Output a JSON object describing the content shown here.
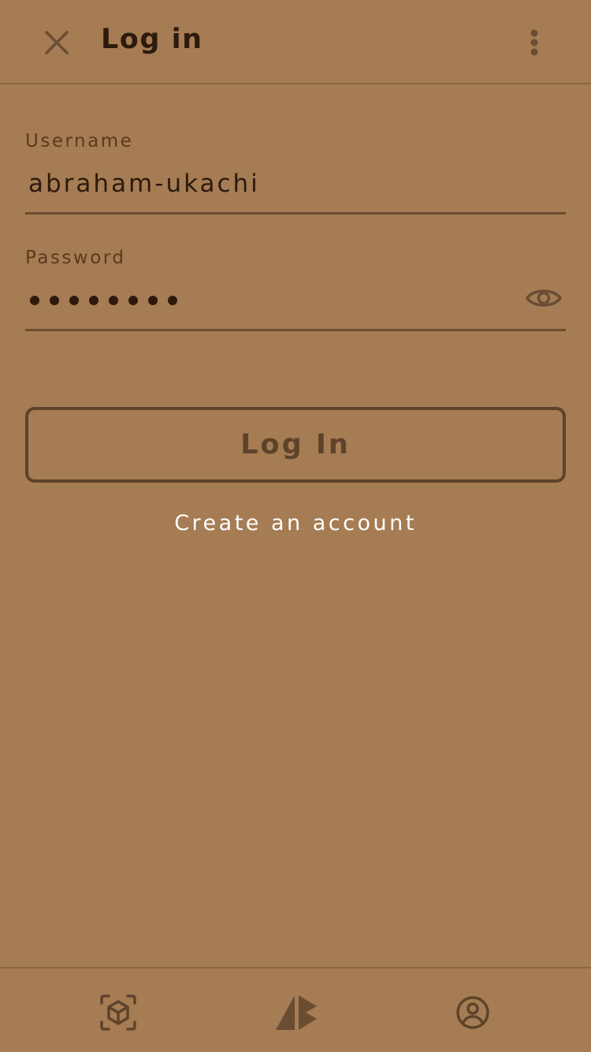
{
  "header": {
    "title": "Log in",
    "close_icon": "close-icon",
    "more_icon": "more-vertical-icon"
  },
  "form": {
    "username": {
      "label": "Username",
      "value": "abraham-ukachi"
    },
    "password": {
      "label": "Password",
      "masked_length": 8,
      "toggle_icon": "eye-icon"
    },
    "login_button_label": "Log In",
    "create_account_label": "Create an account"
  },
  "bottom_nav": {
    "items": [
      {
        "icon": "ar-cube-icon"
      },
      {
        "icon": "logo-icon"
      },
      {
        "icon": "account-circle-icon"
      }
    ]
  },
  "colors": {
    "background": "#a57c53",
    "text_dark": "#2e1a0c",
    "accent_brown": "#5e432b",
    "link_white": "#ffffff"
  }
}
